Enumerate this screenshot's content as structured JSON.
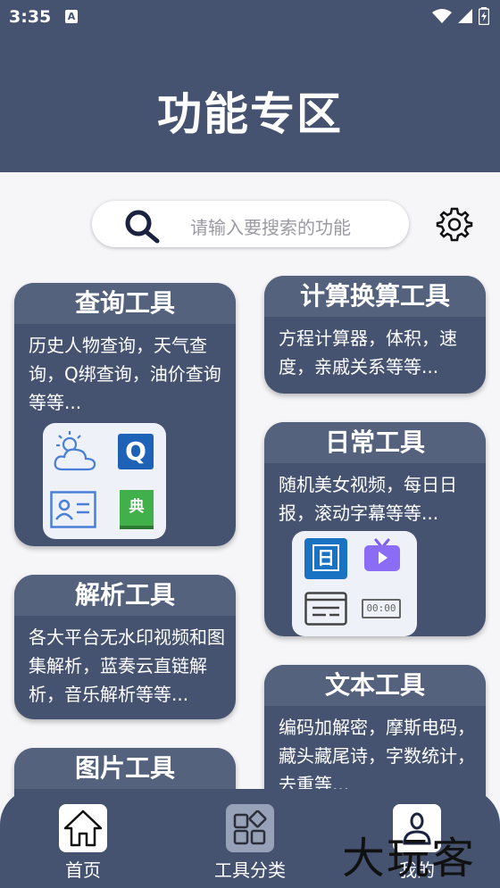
{
  "status_bar": {
    "time": "3:35",
    "a_icon": "A"
  },
  "header": {
    "title": "功能专区"
  },
  "search": {
    "placeholder": "请输入要搜索的功能"
  },
  "cards": {
    "query": {
      "title": "查询工具",
      "desc": "历史人物查询，天气查询，Q绑查询，油价查询等等..."
    },
    "calc": {
      "title": "计算换算工具",
      "desc": "方程计算器，体积，速度，亲戚关系等等..."
    },
    "daily": {
      "title": "日常工具",
      "desc": "随机美女视频，每日日报，滚动字幕等等..."
    },
    "parse": {
      "title": "解析工具",
      "desc": "各大平台无水印视频和图集解析，蓝奏云直链解析，音乐解析等等..."
    },
    "text": {
      "title": "文本工具",
      "desc": "编码加解密，摩斯电码，藏头藏尾诗，字数统计，去重等..."
    },
    "image": {
      "title": "图片工具"
    }
  },
  "icons": {
    "query_q": "Q",
    "query_dict": "典",
    "daily_cal": "日",
    "daily_clock": "00:00"
  },
  "nav": {
    "home": "首页",
    "categories": "工具分类",
    "mine": "我的"
  },
  "watermark": "大玩客",
  "colors": {
    "primary": "#465370",
    "card_head": "#55627d",
    "background": "#f6f6f8"
  }
}
